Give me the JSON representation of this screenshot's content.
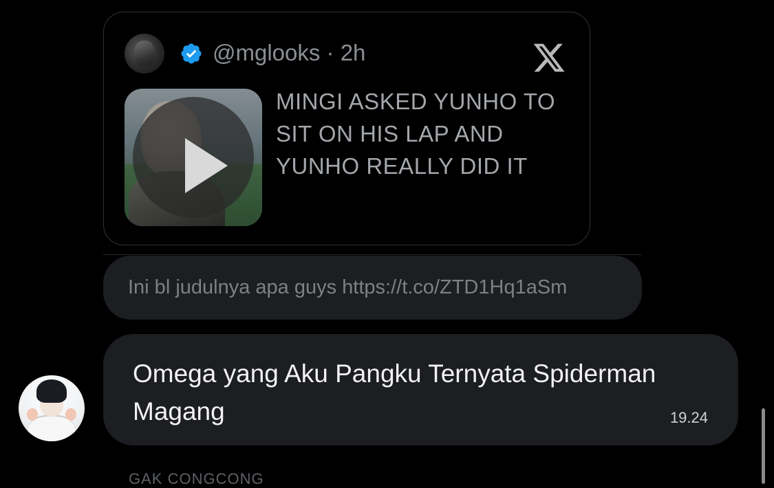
{
  "tweet": {
    "handle_time": "@mglooks · 2h",
    "text": "MINGI ASKED YUNHO TO SIT ON HIS LAP AND YUNHO REALLY DID IT",
    "icons": {
      "verified": "verified-badge-icon",
      "platform": "x-logo-icon",
      "play": "play-icon"
    },
    "colors": {
      "verified": "#1d9bf0",
      "text": "#a3a7ab",
      "handle": "#8b8f94"
    }
  },
  "caption": {
    "text": "Ini bl judulnya apa guys https://t.co/ZTD1Hq1aSm"
  },
  "message": {
    "text": "Omega yang Aku Pangku Ternyata Spiderman Magang",
    "time": "19.24"
  },
  "next_sender": {
    "name": "GAK CONGCONG"
  },
  "colors": {
    "background": "#000000",
    "bubble": "#1c1e21"
  }
}
